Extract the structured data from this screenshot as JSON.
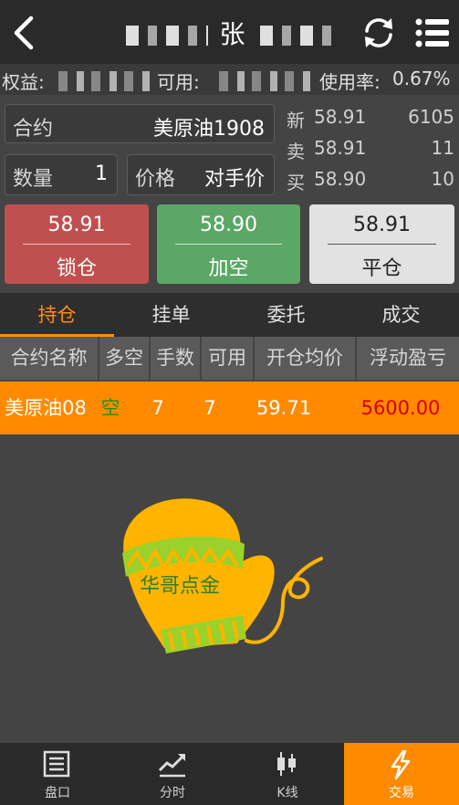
{
  "header": {
    "title": "张",
    "back_icon": "chevron-left-icon",
    "refresh_icon": "refresh-icon",
    "menu_icon": "menu-icon"
  },
  "account": {
    "equity_label": "权益:",
    "available_label": "可用:",
    "usage_label": "使用率:",
    "usage_value": "0.67%"
  },
  "form": {
    "contract_label": "合约",
    "contract_value": "美原油1908",
    "qty_label": "数量",
    "qty_value": "1",
    "price_label": "价格",
    "price_value": "对手价"
  },
  "quote": {
    "rows": [
      {
        "label": "新",
        "price": "58.91",
        "volume": "6105"
      },
      {
        "label": "卖",
        "price": "58.91",
        "volume": "11"
      },
      {
        "label": "买",
        "price": "58.90",
        "volume": "10"
      }
    ]
  },
  "actions": {
    "lock": {
      "price": "58.91",
      "label": "锁仓"
    },
    "short": {
      "price": "58.90",
      "label": "加空"
    },
    "close": {
      "price": "58.91",
      "label": "平仓"
    }
  },
  "tabs": [
    "持仓",
    "挂单",
    "委托",
    "成交"
  ],
  "table": {
    "headers": [
      "合约名称",
      "多空",
      "手数",
      "可用",
      "开仓均价",
      "浮动盈亏"
    ],
    "rows": [
      {
        "name": "美原油08",
        "direction": "空",
        "lots": "7",
        "available": "7",
        "avg_price": "59.71",
        "pnl": "5600.00"
      }
    ]
  },
  "mascot_text": "华哥点金",
  "nav": [
    {
      "label": "盘口",
      "icon": "orderbook-icon"
    },
    {
      "label": "分时",
      "icon": "intraday-chart-icon"
    },
    {
      "label": "K线",
      "icon": "candlestick-icon"
    },
    {
      "label": "交易",
      "icon": "lightning-icon"
    }
  ],
  "colors": {
    "accent": "#ff8a00",
    "lock": "#c0504f",
    "short": "#5aa766",
    "pnl": "#d50000",
    "short_dir": "#2e8b1e"
  }
}
